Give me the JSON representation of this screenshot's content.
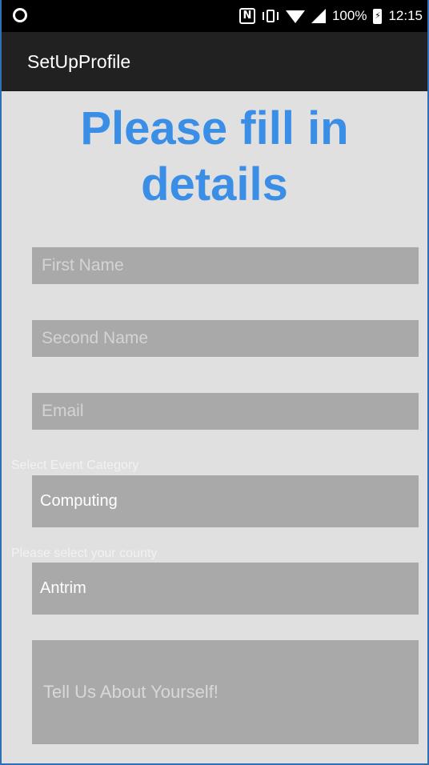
{
  "status_bar": {
    "battery": "100%",
    "time": "12:15",
    "nfc": "N"
  },
  "toolbar": {
    "title": "SetUpProfile"
  },
  "heading": {
    "line1": "Please fill in",
    "line2": "details"
  },
  "form": {
    "first_name": {
      "placeholder": "First Name",
      "value": ""
    },
    "second_name": {
      "placeholder": "Second Name",
      "value": ""
    },
    "email": {
      "placeholder": "Email",
      "value": ""
    },
    "event_category": {
      "label": "Select Event Category",
      "selected": "Computing"
    },
    "county": {
      "label": "Please select your county",
      "selected": "Antrim"
    },
    "about": {
      "placeholder": "Tell Us About Yourself!"
    }
  },
  "colors": {
    "heading": "#3a8ee6",
    "background": "#e0e0e0",
    "field": "#a9a9a9",
    "toolbar": "#212121"
  }
}
